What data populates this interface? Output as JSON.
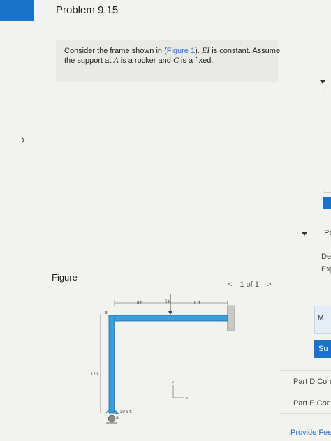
{
  "title": "Problem 9.15",
  "problem": {
    "t1": "Consider the frame shown in (",
    "link": "Figure 1",
    "t2": "). ",
    "ei": "EI",
    "t3": " is constant. Assume the support at ",
    "a": "A",
    "t4": " is a rocker and ",
    "c": "C",
    "t5": " is a fixed."
  },
  "figure": {
    "label": "Figure",
    "pager": {
      "prev": "<",
      "text": "1 of 1",
      "next": ">"
    },
    "labels": {
      "load": "6 k",
      "dim1": "8 ft",
      "dim2": "8 ft",
      "height": "12 ft",
      "moment": "30 k·ft",
      "b": "B",
      "c": "C",
      "a": "A",
      "y": "y",
      "x": "x"
    }
  },
  "right_panel": {
    "pa": "Pa",
    "det": "Det",
    "exp": "Exp",
    "m": "M",
    "su": "Su",
    "part_d": "Part D  Con",
    "part_e": "Part E  Con",
    "feedback": "Provide Feed"
  },
  "colors": {
    "member": "#3aa0d8",
    "accent": "#1a73c9"
  }
}
